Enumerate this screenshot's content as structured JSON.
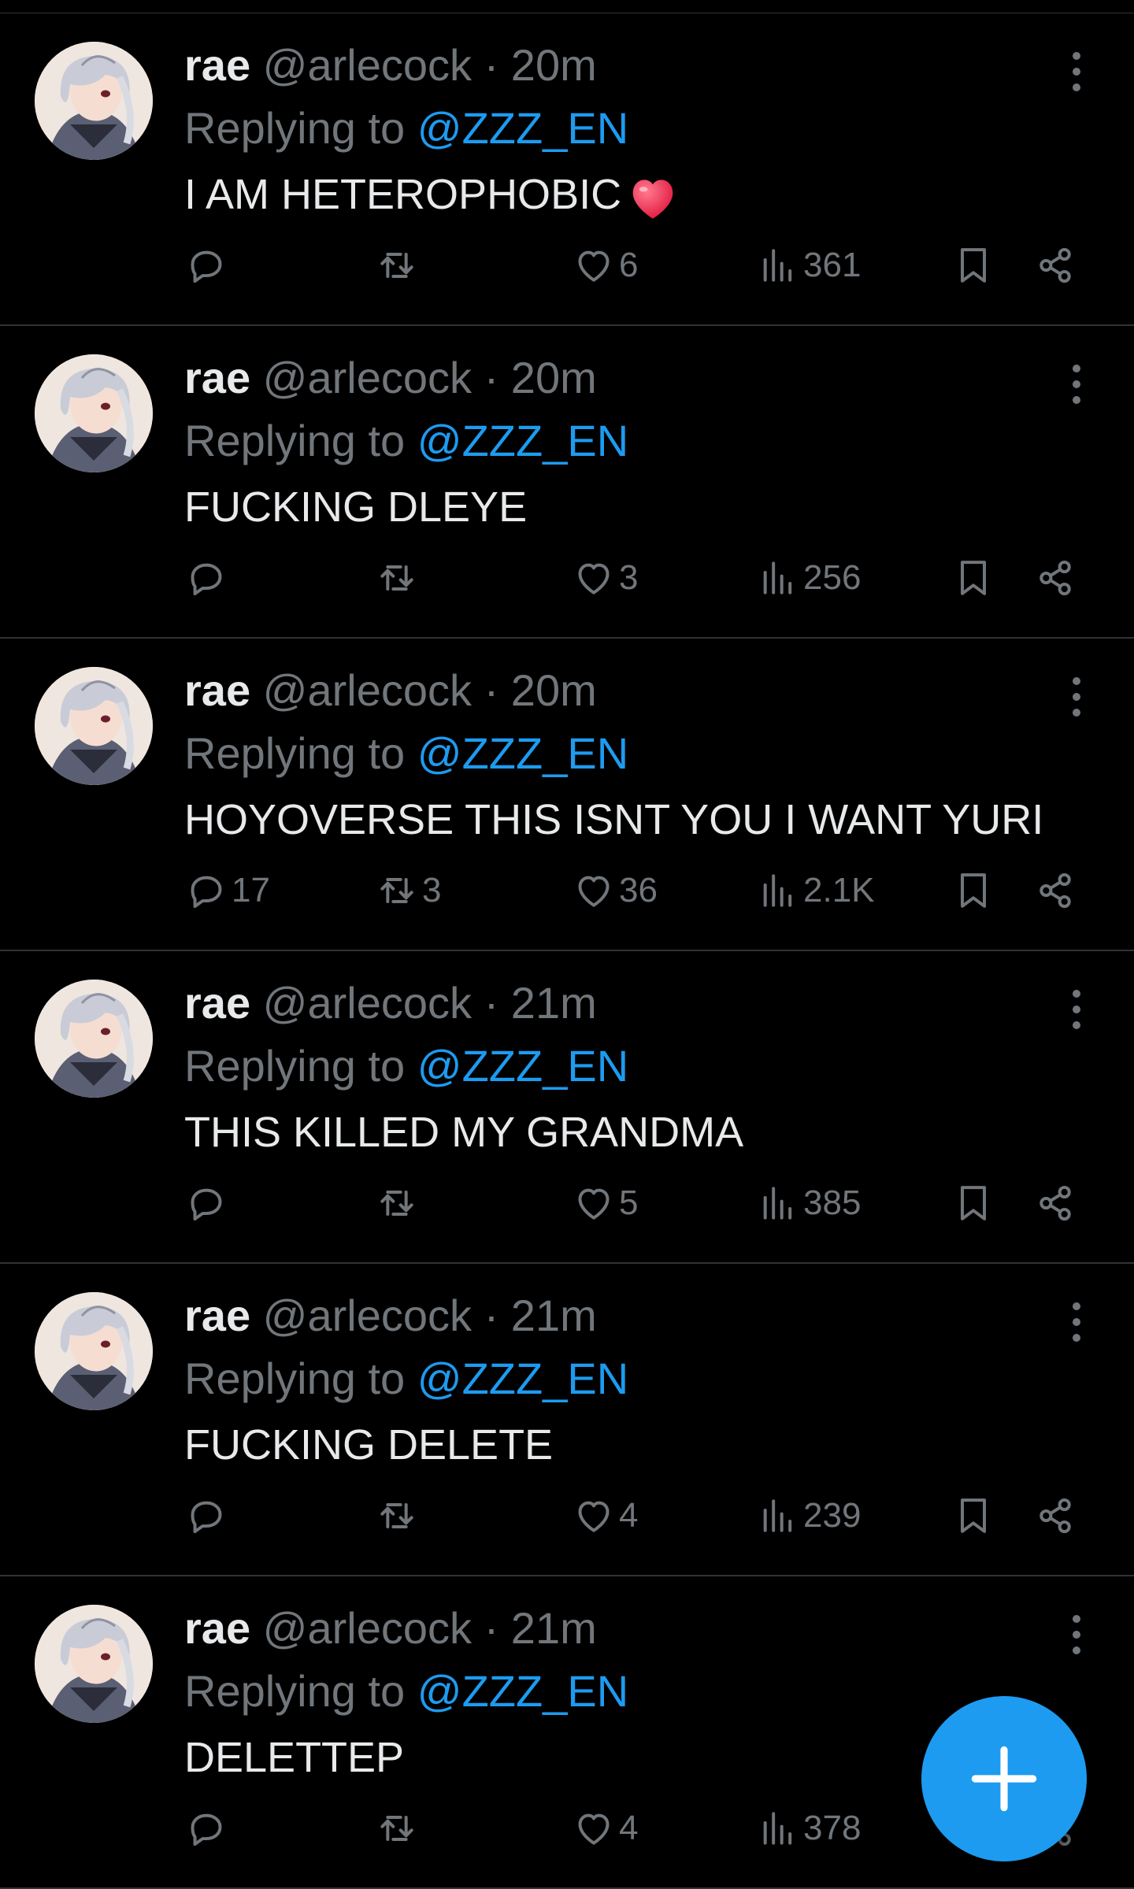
{
  "colors": {
    "background": "#000000",
    "text": "#e7e9ea",
    "muted": "#71767b",
    "accent": "#1d9bf0",
    "divider": "#2f3336"
  },
  "tweets": [
    {
      "name": "rae",
      "handle": "@arlecock",
      "time": "· 20m",
      "replying_label": "Replying to",
      "replying_to": "@ZZZ_EN",
      "text": "I AM HETEROPHOBIC",
      "emoji": "red-heart-emoji",
      "replies": "",
      "retweets": "",
      "likes": "6",
      "views": "361"
    },
    {
      "name": "rae",
      "handle": "@arlecock",
      "time": "· 20m",
      "replying_label": "Replying to",
      "replying_to": "@ZZZ_EN",
      "text": "FUCKING DLEYE",
      "replies": "",
      "retweets": "",
      "likes": "3",
      "views": "256"
    },
    {
      "name": "rae",
      "handle": "@arlecock",
      "time": "· 20m",
      "replying_label": "Replying to",
      "replying_to": "@ZZZ_EN",
      "text": "HOYOVERSE THIS ISNT YOU I WANT YURI",
      "replies": "17",
      "retweets": "3",
      "likes": "36",
      "views": "2.1K"
    },
    {
      "name": "rae",
      "handle": "@arlecock",
      "time": "· 21m",
      "replying_label": "Replying to",
      "replying_to": "@ZZZ_EN",
      "text": "THIS KILLED MY GRANDMA",
      "replies": "",
      "retweets": "",
      "likes": "5",
      "views": "385"
    },
    {
      "name": "rae",
      "handle": "@arlecock",
      "time": "· 21m",
      "replying_label": "Replying to",
      "replying_to": "@ZZZ_EN",
      "text": "FUCKING DELETE",
      "replies": "",
      "retweets": "",
      "likes": "4",
      "views": "239"
    },
    {
      "name": "rae",
      "handle": "@arlecock",
      "time": "· 21m",
      "replying_label": "Replying to",
      "replying_to": "@ZZZ_EN",
      "text": "DELETTEP",
      "replies": "",
      "retweets": "",
      "likes": "4",
      "views": "378"
    }
  ],
  "compose_button": {
    "icon": "plus-icon"
  }
}
